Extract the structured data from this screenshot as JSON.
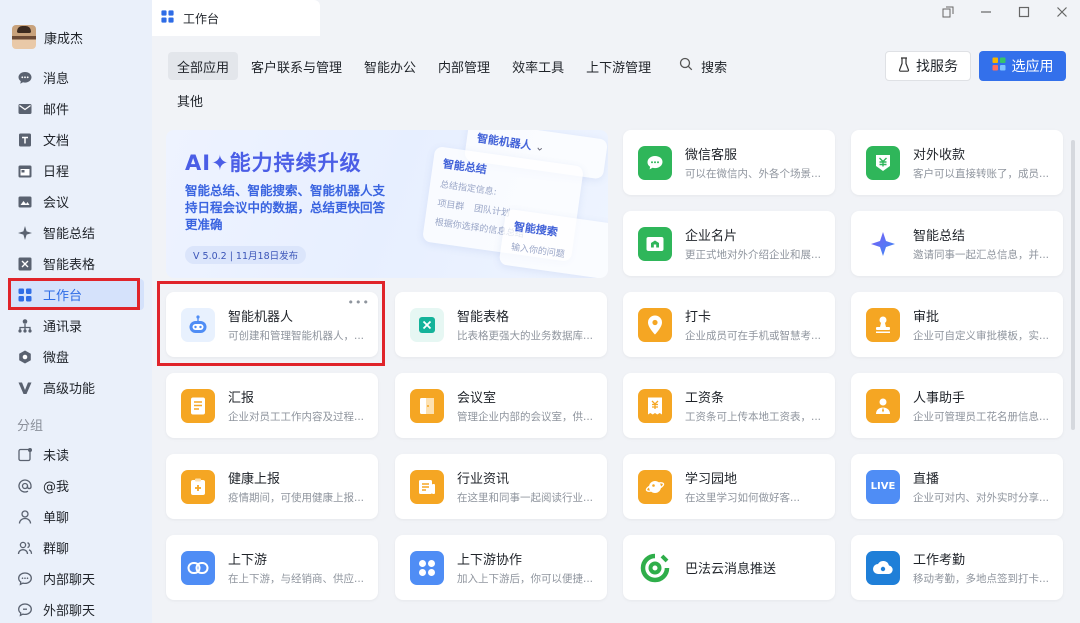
{
  "user": {
    "name": "康成杰"
  },
  "nav": [
    {
      "label": "消息",
      "icon": "message-icon"
    },
    {
      "label": "邮件",
      "icon": "mail-icon"
    },
    {
      "label": "文档",
      "icon": "doc-icon"
    },
    {
      "label": "日程",
      "icon": "calendar-icon"
    },
    {
      "label": "会议",
      "icon": "meeting-icon"
    },
    {
      "label": "智能总结",
      "icon": "sparkle-icon"
    },
    {
      "label": "智能表格",
      "icon": "smart-table-icon"
    },
    {
      "label": "工作台",
      "icon": "workbench-icon"
    },
    {
      "label": "通讯录",
      "icon": "contacts-icon"
    },
    {
      "label": "微盘",
      "icon": "drive-icon"
    },
    {
      "label": "高级功能",
      "icon": "premium-icon"
    }
  ],
  "groups": {
    "label": "分组",
    "items": [
      {
        "label": "未读",
        "icon": "unread-icon"
      },
      {
        "label": "@我",
        "icon": "at-icon"
      },
      {
        "label": "单聊",
        "icon": "person-icon"
      },
      {
        "label": "群聊",
        "icon": "group-icon"
      },
      {
        "label": "内部聊天",
        "icon": "chat-icon"
      },
      {
        "label": "外部聊天",
        "icon": "external-chat-icon"
      }
    ]
  },
  "tab": {
    "title": "工作台"
  },
  "filters": [
    "全部应用",
    "客户联系与管理",
    "智能办公",
    "内部管理",
    "效率工具",
    "上下游管理"
  ],
  "search_label": "搜索",
  "filter_other": "其他",
  "buttons": {
    "service": "找服务",
    "select_app": "选应用"
  },
  "banner": {
    "title": "AI✦能力持续升级",
    "desc": "智能总结、智能搜索、智能机器人支持日程会议中的数据，总结更快回答更准确",
    "tag": "V 5.0.2 | 11月18日发布",
    "card_robot": "智能机器人",
    "card_summary": "智能总结",
    "card_summary_sub": "总结指定信息:",
    "card_search": "智能搜索",
    "card_search_sub": "输入你的问题",
    "card_source_1": "项目群",
    "card_source_2": "团队计划",
    "card_summary_hint": "根据你选择的信息总结"
  },
  "apps": [
    {
      "name": "微信客服",
      "desc": "可以在微信内、外各个场景...",
      "icon": "wechat-service-icon",
      "color": "#2fb65a"
    },
    {
      "name": "对外收款",
      "desc": "客户可以直接转账了，成员...",
      "icon": "payment-icon",
      "color": "#2fb65a"
    },
    {
      "name": "企业名片",
      "desc": "更正式地对外介绍企业和展...",
      "icon": "business-card-icon",
      "color": "#2fb65a"
    },
    {
      "name": "智能总结",
      "desc": "邀请同事一起汇总信息，并...",
      "icon": "sparkle-icon",
      "color": "#5a7ff0"
    },
    {
      "name": "智能机器人",
      "desc": "可创建和管理智能机器人，...",
      "icon": "robot-icon",
      "color": "#4f8df5"
    },
    {
      "name": "智能表格",
      "desc": "比表格更强大的业务数据库...",
      "icon": "smart-table-icon",
      "color": "#14b39a"
    },
    {
      "name": "打卡",
      "desc": "企业成员可在手机或智慧考...",
      "icon": "checkin-icon",
      "color": "#f5a623"
    },
    {
      "name": "审批",
      "desc": "企业可自定义审批模板，实...",
      "icon": "approval-icon",
      "color": "#f5a623"
    },
    {
      "name": "汇报",
      "desc": "企业对员工工作内容及过程...",
      "icon": "report-icon",
      "color": "#f5a623"
    },
    {
      "name": "会议室",
      "desc": "管理企业内部的会议室，供...",
      "icon": "meeting-room-icon",
      "color": "#f5a623"
    },
    {
      "name": "工资条",
      "desc": "工资条可上传本地工资表，...",
      "icon": "payslip-icon",
      "color": "#f5a623"
    },
    {
      "name": "人事助手",
      "desc": "企业可管理员工花名册信息...",
      "icon": "hr-icon",
      "color": "#f5a623"
    },
    {
      "name": "健康上报",
      "desc": "疫情期间，可使用健康上报...",
      "icon": "health-icon",
      "color": "#f5a623"
    },
    {
      "name": "行业资讯",
      "desc": "在这里和同事一起阅读行业...",
      "icon": "news-icon",
      "color": "#f5a623"
    },
    {
      "name": "学习园地",
      "desc": "在这里学习如何做好客...",
      "icon": "learning-icon",
      "color": "#f5a623"
    },
    {
      "name": "直播",
      "desc": "企业可对内、对外实时分享...",
      "icon": "live-icon",
      "color": "#4f8df5"
    },
    {
      "name": "上下游",
      "desc": "在上下游，与经销商、供应...",
      "icon": "upstream-icon",
      "color": "#4f8df5"
    },
    {
      "name": "上下游协作",
      "desc": "加入上下游后，你可以便捷...",
      "icon": "collab-icon",
      "color": "#4f8df5"
    },
    {
      "name": "巴法云消息推送",
      "desc": "",
      "icon": "bafa-icon",
      "color": "#2fb65a"
    },
    {
      "name": "工作考勤",
      "desc": "移动考勤，多地点签到打卡...",
      "icon": "attendance-icon",
      "color": "#1f7fd8"
    }
  ]
}
